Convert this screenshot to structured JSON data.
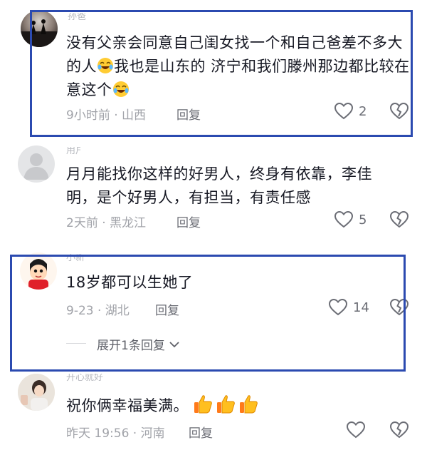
{
  "comments": [
    {
      "username": "孙爸",
      "text_parts": [
        "没有父亲会同意自己闺女找一个和自己爸差不多大的人",
        "我也是山东的  济宁和我们滕州那边都比较在意这个"
      ],
      "meta": "9小时前 · 山西",
      "reply_label": "回复",
      "likes": "2"
    },
    {
      "username": "用户",
      "text": "月月能找你这样的好男人，终身有依靠，李佳明，是个好男人，有担当，有责任感",
      "meta": "2天前 · 黑龙江",
      "reply_label": "回复",
      "likes": "5"
    },
    {
      "username": "小新",
      "text": "18岁都可以生她了",
      "meta": "9-23 · 湖北",
      "reply_label": "回复",
      "likes": "14",
      "expand_label": "展开1条回复"
    },
    {
      "username": "开心就好",
      "text": "祝你俩幸福美满。",
      "meta": "昨天 19:56 · 河南",
      "reply_label": "回复",
      "likes": ""
    }
  ],
  "icons": {
    "like": "heart-outline-icon",
    "dislike": "broken-heart-icon",
    "laugh": "laugh-crying-emoji-icon",
    "thumbs": "thumbs-up-emoji-icon",
    "chevron": "chevron-down-icon"
  },
  "colors": {
    "highlight_box": "#2b4ab0",
    "text": "#161823",
    "meta": "#a1a3a9"
  }
}
